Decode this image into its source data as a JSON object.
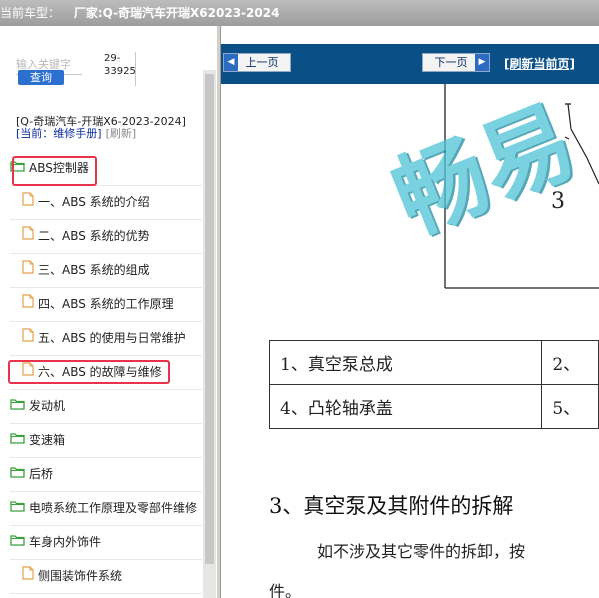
{
  "titlebar": {
    "label": "当前车型：",
    "vendor": "厂家:Q-奇瑞汽车开瑞X62023-2024"
  },
  "search": {
    "placeholder": "输入关键字",
    "query_label": "查询",
    "code_line1": "29-",
    "code_line2": "33925"
  },
  "vehicle": {
    "name": "[Q-奇瑞汽车-开瑞X6-2023-2024]",
    "mode": "[当前：维修手册]",
    "refresh": "[刷新]"
  },
  "tree": [
    {
      "label": "ABS控制器",
      "type": "folder",
      "highlighted": true
    },
    {
      "label": "一、ABS 系统的介绍",
      "type": "doc"
    },
    {
      "label": "二、ABS 系统的优势",
      "type": "doc"
    },
    {
      "label": "三、ABS 系统的组成",
      "type": "doc"
    },
    {
      "label": "四、ABS 系统的工作原理",
      "type": "doc"
    },
    {
      "label": "五、ABS 的使用与日常维护",
      "type": "doc"
    },
    {
      "label": "六、ABS 的故障与维修",
      "type": "doc",
      "highlighted": true
    },
    {
      "label": "发动机",
      "type": "folder"
    },
    {
      "label": "变速箱",
      "type": "folder"
    },
    {
      "label": "后桥",
      "type": "folder"
    },
    {
      "label": "电喷系统工作原理及零部件维修",
      "type": "folder"
    },
    {
      "label": "车身内外饰件",
      "type": "folder"
    },
    {
      "label": "侧围装饰件系统",
      "type": "doc"
    }
  ],
  "toolbar": {
    "prev_label": "上一页",
    "next_label": "下一页",
    "refresh_label": "[刷新当前页]"
  },
  "document": {
    "diagram_number": "3",
    "watermark": "畅易",
    "table": [
      [
        "1、真空泵总成",
        "2、"
      ],
      [
        "4、凸轮轴承盖",
        "5、"
      ]
    ],
    "section_title": "3、真空泵及其附件的拆解",
    "paragraph": "如不涉及其它零件的拆卸，按",
    "paragraph_cont": "件。"
  },
  "colors": {
    "toolbar_bg": "#0a4f86",
    "highlight": "#e8344a",
    "folder_icon": "#3aa13a",
    "doc_icon": "#e6a04a",
    "watermark": "#4ec3d8"
  }
}
